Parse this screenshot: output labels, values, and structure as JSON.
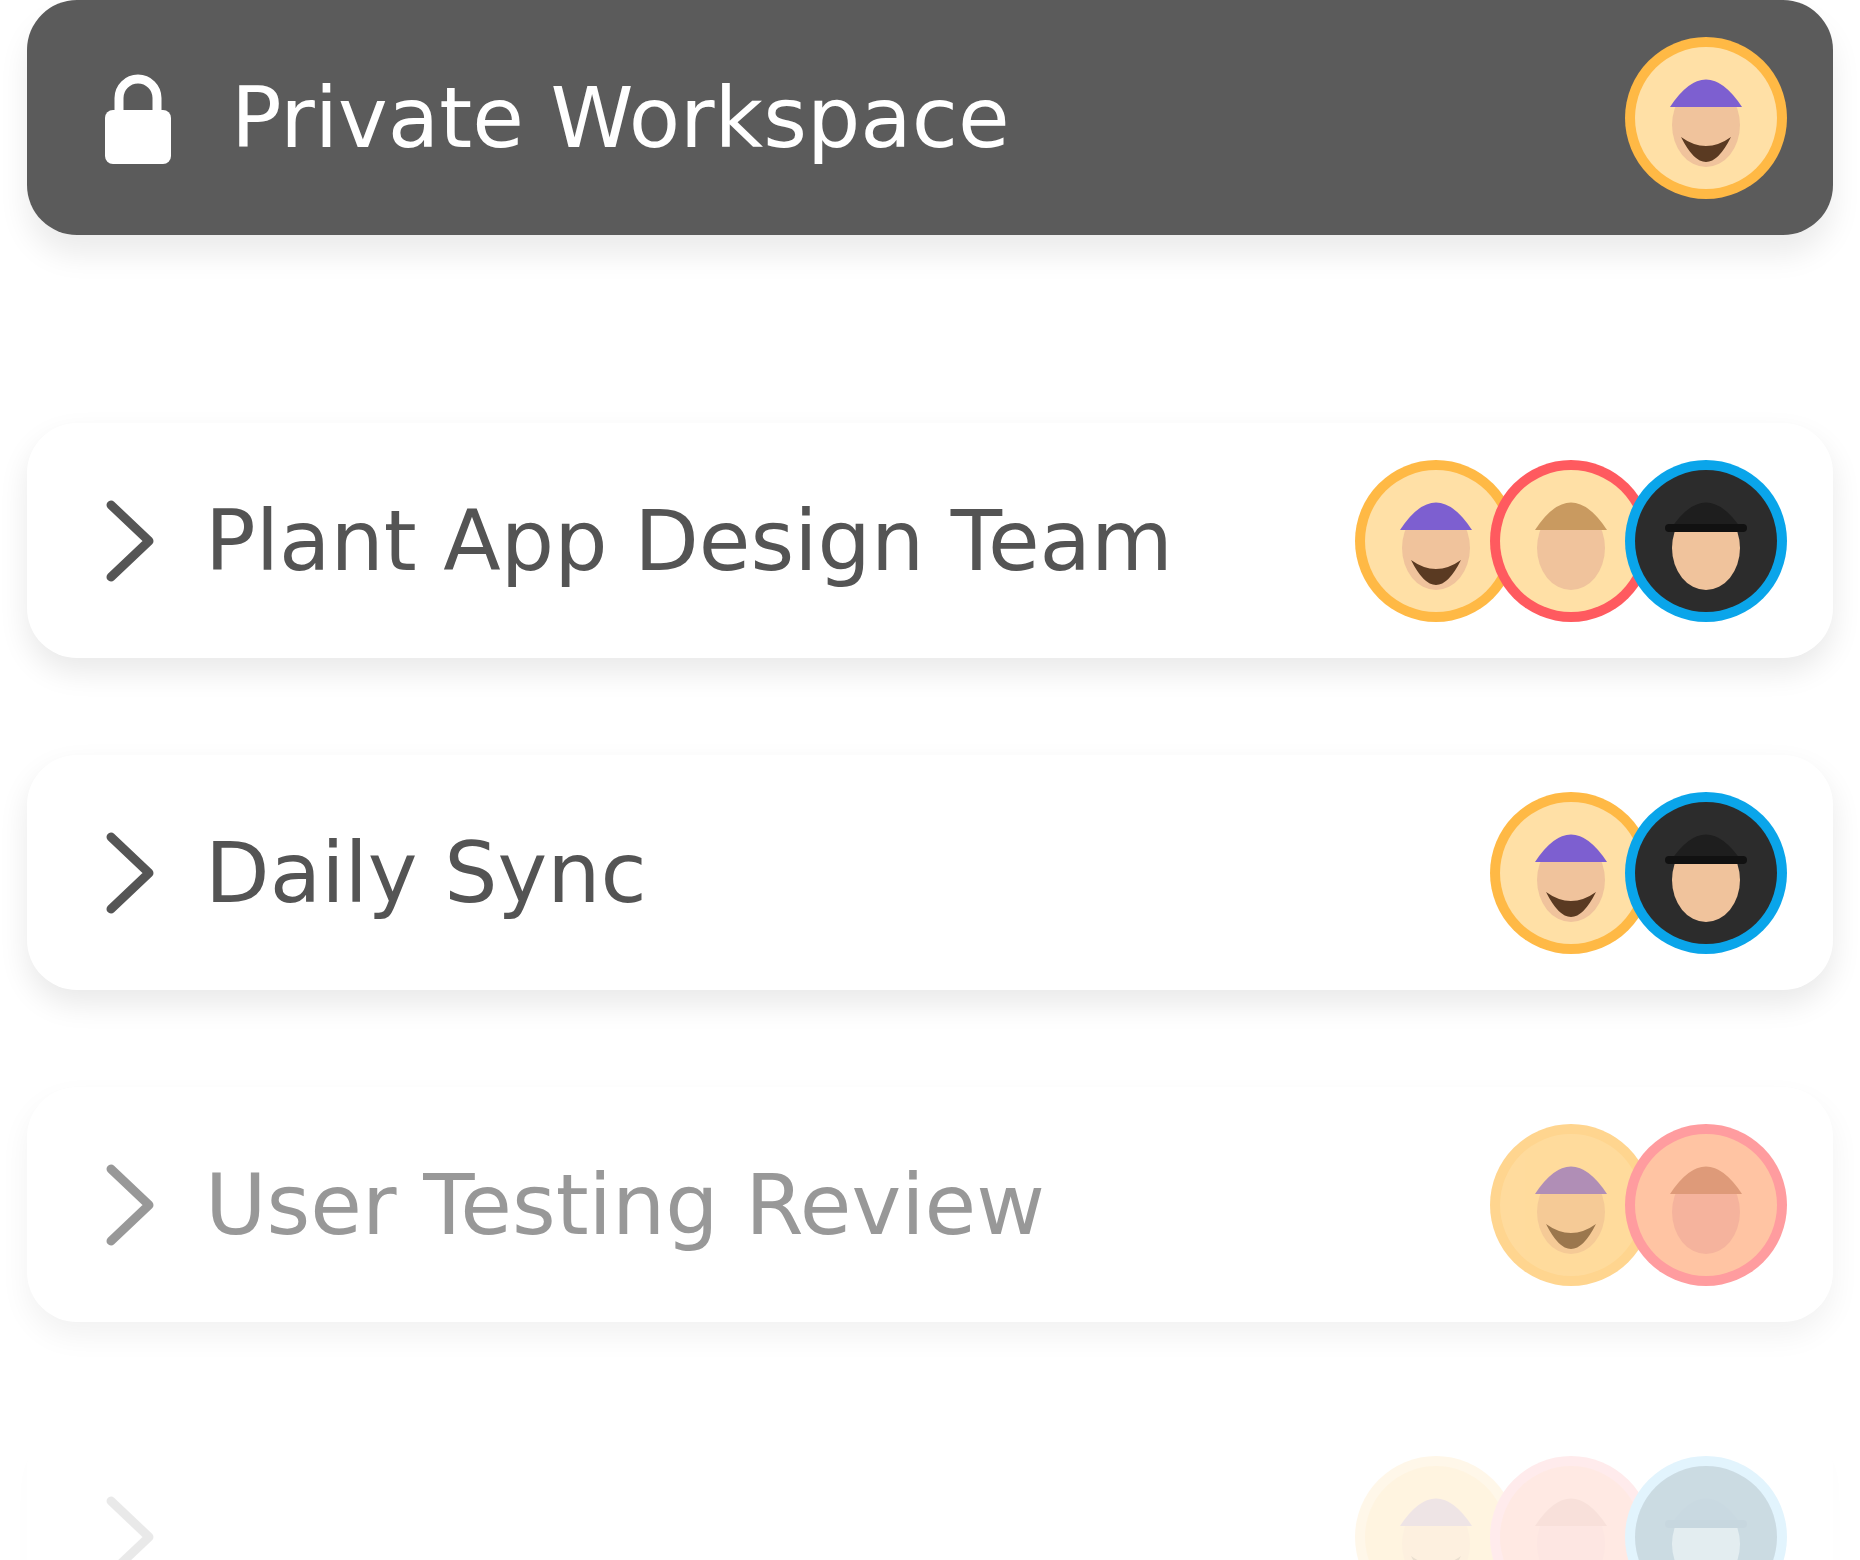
{
  "workspace": {
    "title": "Private Workspace",
    "locked": true,
    "avatars": [
      {
        "kind": "beanie",
        "color": "#ffb945"
      }
    ]
  },
  "channels": [
    {
      "title": "Plant App Design Team",
      "kind": "normal",
      "avatars": [
        {
          "kind": "beanie",
          "color": "#ffb945"
        },
        {
          "kind": "blond",
          "color": "#ff5a5f"
        },
        {
          "kind": "cap",
          "color": "#0aa5ea"
        }
      ]
    },
    {
      "title": "Daily Sync",
      "kind": "normal",
      "avatars": [
        {
          "kind": "beanie",
          "color": "#ffb945"
        },
        {
          "kind": "cap",
          "color": "#0aa5ea"
        }
      ]
    },
    {
      "title": "User Testing Review",
      "kind": "faded",
      "avatars": [
        {
          "kind": "beanie",
          "color": "#ffd58f"
        },
        {
          "kind": "blond",
          "color": "#ff9c9f"
        }
      ]
    },
    {
      "kind": "fading",
      "avatars": [
        {
          "kind": "beanie",
          "color": "#fff7e9"
        },
        {
          "kind": "blond",
          "color": "#ffebec"
        },
        {
          "kind": "cap",
          "color": "#e2f4fd"
        }
      ]
    }
  ]
}
